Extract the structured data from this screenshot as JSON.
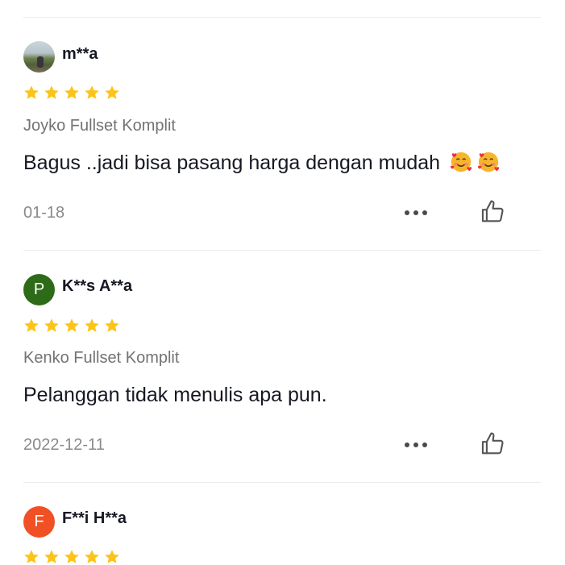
{
  "reviews": [
    {
      "username": "m**a",
      "avatar": {
        "type": "photo",
        "icon": "landscape-photo"
      },
      "rating": 5,
      "variant": "Joyko Fullset Komplit",
      "text": "Bagus ..jadi bisa pasang harga dengan mudah",
      "emojis": [
        "smiling-face-with-hearts",
        "smiling-face-with-hearts"
      ],
      "date": "01-18"
    },
    {
      "username": "K**s A**a",
      "avatar": {
        "type": "letter",
        "letter": "P",
        "color": "#2e6b19"
      },
      "rating": 5,
      "variant": "Kenko Fullset Komplit",
      "text": "Pelanggan tidak menulis apa pun.",
      "emojis": [],
      "date": "2022-12-11"
    },
    {
      "username": "F**i H**a",
      "avatar": {
        "type": "letter",
        "letter": "F",
        "color": "#f05023"
      },
      "rating": 5
    }
  ],
  "colors": {
    "star": "#fcc419",
    "text": "#161823",
    "muted": "#737373",
    "divider": "#ececec"
  }
}
